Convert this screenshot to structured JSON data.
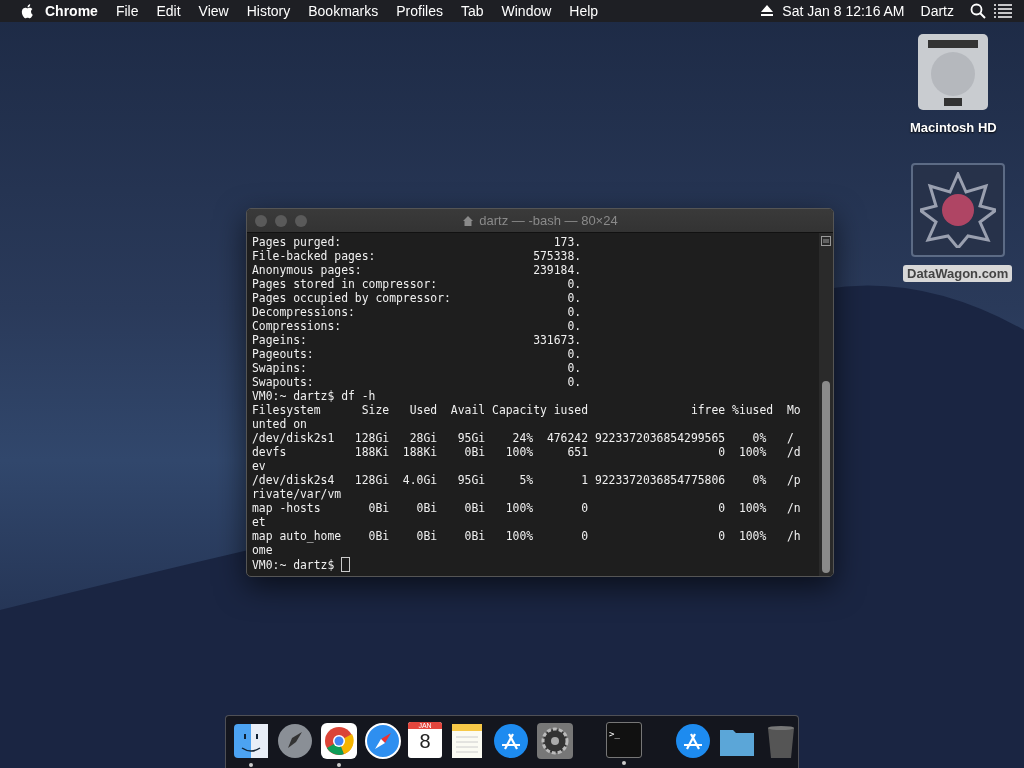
{
  "menu_bar": {
    "items": [
      {
        "label": "Chrome",
        "kind": "app"
      },
      {
        "label": "File",
        "kind": "menu"
      },
      {
        "label": "Edit",
        "kind": "menu"
      },
      {
        "label": "View",
        "kind": "menu"
      },
      {
        "label": "History",
        "kind": "menu"
      },
      {
        "label": "Bookmarks",
        "kind": "menu"
      },
      {
        "label": "Profiles",
        "kind": "menu"
      },
      {
        "label": "Tab",
        "kind": "menu"
      },
      {
        "label": "Window",
        "kind": "menu"
      },
      {
        "label": "Help",
        "kind": "menu"
      }
    ],
    "clock": "Sat Jan 8  12:16 AM",
    "user": "Dartz"
  },
  "desktop_icons": [
    {
      "kind": "disk",
      "label": "Macintosh HD"
    },
    {
      "kind": "image",
      "label": "DataWagon.com"
    }
  ],
  "terminal": {
    "title": "dartz — -bash — 80×24",
    "stats": [
      {
        "label": "Pages purged:",
        "value": "173."
      },
      {
        "label": "File-backed pages:",
        "value": "575338."
      },
      {
        "label": "Anonymous pages:",
        "value": "239184."
      },
      {
        "label": "Pages stored in compressor:",
        "value": "0."
      },
      {
        "label": "Pages occupied by compressor:",
        "value": "0."
      },
      {
        "label": "Decompressions:",
        "value": "0."
      },
      {
        "label": "Compressions:",
        "value": "0."
      },
      {
        "label": "Pageins:",
        "value": "331673."
      },
      {
        "label": "Pageouts:",
        "value": "0."
      },
      {
        "label": "Swapins:",
        "value": "0."
      },
      {
        "label": "Swapouts:",
        "value": "0."
      }
    ],
    "lines": [
      "VM0:~ dartz$ df -h",
      "Filesystem      Size   Used  Avail Capacity iused               ifree %iused  Mo",
      "unted on",
      "/dev/disk2s1   128Gi   28Gi   95Gi    24%  476242 9223372036854299565    0%   /",
      "devfs          188Ki  188Ki    0Bi   100%     651                   0  100%   /d",
      "ev",
      "/dev/disk2s4   128Gi  4.0Gi   95Gi     5%       1 9223372036854775806    0%   /p",
      "rivate/var/vm",
      "map -hosts       0Bi    0Bi    0Bi   100%       0                   0  100%   /n",
      "et",
      "map auto_home    0Bi    0Bi    0Bi   100%       0                   0  100%   /h",
      "ome"
    ],
    "prompt": "VM0:~ dartz$ "
  },
  "dock": [
    {
      "kind": "finder",
      "running": true
    },
    {
      "kind": "rocket",
      "running": false
    },
    {
      "kind": "chrome",
      "running": true
    },
    {
      "kind": "compass",
      "running": false
    },
    {
      "kind": "calendar",
      "running": false,
      "month": "JAN",
      "day": "8"
    },
    {
      "kind": "notes",
      "running": false
    },
    {
      "kind": "appstore",
      "running": false
    },
    {
      "kind": "gear",
      "running": false
    },
    {
      "kind": "separator"
    },
    {
      "kind": "terminal",
      "running": true,
      "glyph": ">_"
    },
    {
      "kind": "separator"
    },
    {
      "kind": "appstore",
      "running": false
    },
    {
      "kind": "folder",
      "running": false
    },
    {
      "kind": "trash",
      "running": false
    }
  ]
}
